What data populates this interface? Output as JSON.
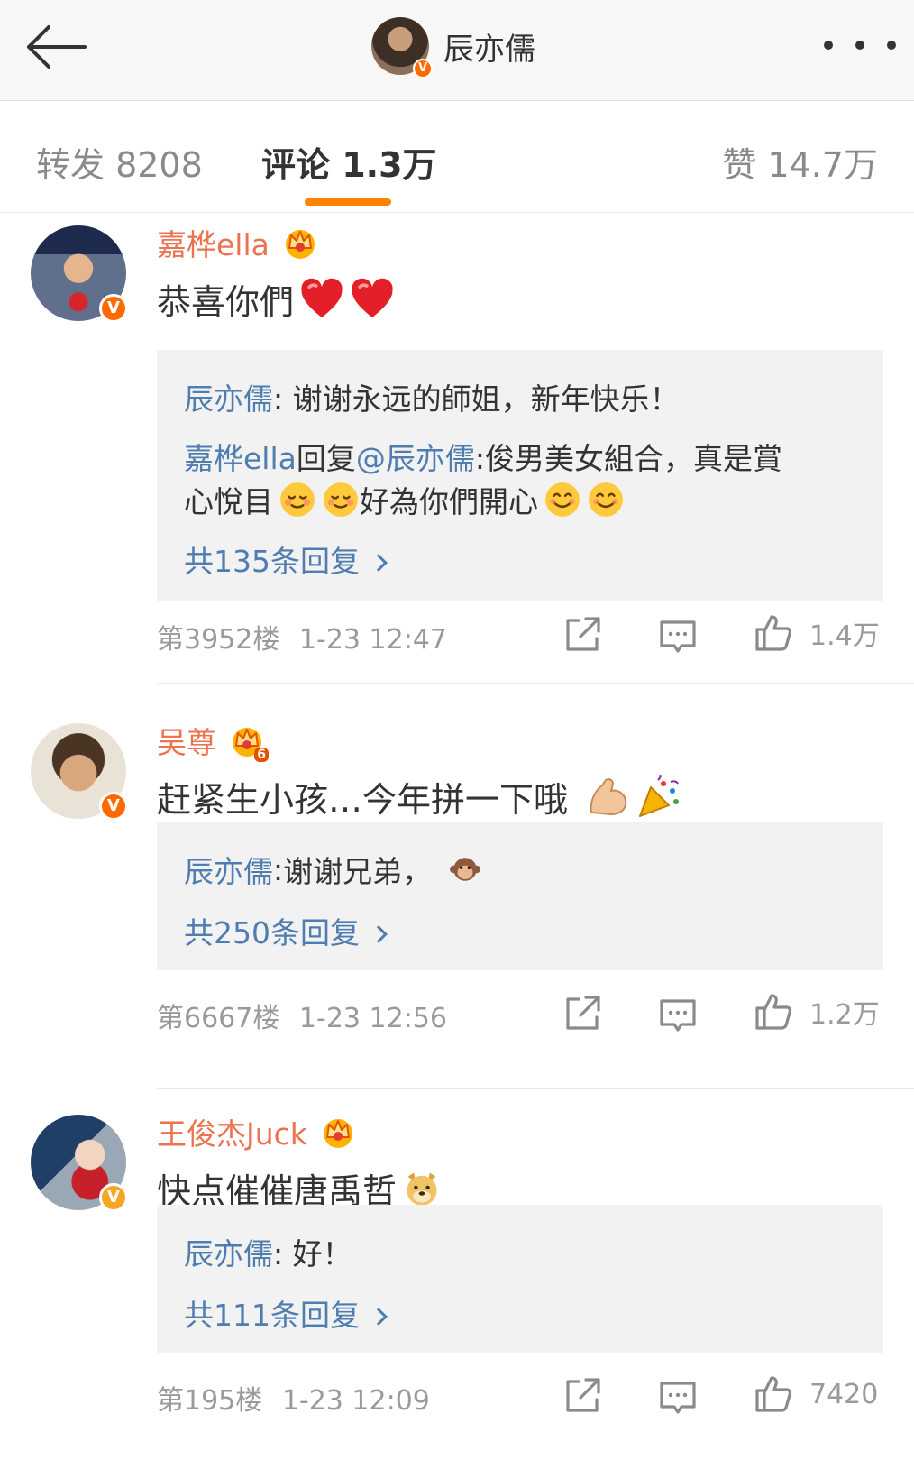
{
  "header": {
    "back_icon": "arrow-left-icon",
    "title": "辰亦儒",
    "verified_mark": "V",
    "more_icon": "more-dots-icon"
  },
  "tabs": {
    "repost": "转发 8208",
    "comments": "评论 1.3万",
    "likes": "赞 14.7万",
    "active": "comments",
    "accent_color": "#ff8200"
  },
  "colors": {
    "author": "#eb7350",
    "link": "#507daf",
    "verified": "#ff6a00",
    "meta": "#9a9a9a"
  },
  "comments": [
    {
      "author": "嘉桦ella",
      "verified_mark": "V",
      "crown_icon": "vip-crown-icon",
      "text": "恭喜你們",
      "emojis": [
        "red-heart-icon",
        "red-heart-icon"
      ],
      "replies": [
        {
          "name": "辰亦儒",
          "sep": ": ",
          "text": "谢谢永远的師姐，新年快乐！"
        },
        {
          "name": "嘉桦ella",
          "mid": "回复",
          "mention": "@辰亦儒",
          "sep": ":",
          "text": "俊男美女組合，真是賞",
          "text_line2": "心悅目",
          "text_line2b": "好為你們開心",
          "emojis_a": [
            "relieved-face-icon",
            "relieved-face-icon"
          ],
          "emojis_b": [
            "smiling-face-icon",
            "smiling-face-icon"
          ]
        }
      ],
      "more_replies": "共135条回复",
      "floor": "第3952楼",
      "time": "1-23 12:47",
      "likes": "1.4万"
    },
    {
      "author": "吴尊",
      "verified_mark": "V",
      "crown_icon": "vip-crown-icon",
      "crown_level": "6",
      "text": "赶紧生小孩…今年拼一下哦",
      "emojis": [
        "flexed-biceps-icon",
        "party-popper-icon"
      ],
      "replies": [
        {
          "name": "辰亦儒",
          "sep": ": ",
          "text": "谢谢兄弟，",
          "emoji": "monkey-face-icon"
        }
      ],
      "more_replies": "共250条回复",
      "floor": "第6667楼",
      "time": "1-23 12:56",
      "likes": "1.2万"
    },
    {
      "author": "王俊杰Juck",
      "verified_mark": "V",
      "crown_icon": "vip-crown-icon",
      "text": "快点催催唐禹哲",
      "emojis": [
        "doge-face-icon"
      ],
      "replies": [
        {
          "name": "辰亦儒",
          "sep": ": ",
          "text": "好！"
        }
      ],
      "more_replies": "共111条回复",
      "floor": "第195楼",
      "time": "1-23 12:09",
      "likes": "7420"
    }
  ]
}
